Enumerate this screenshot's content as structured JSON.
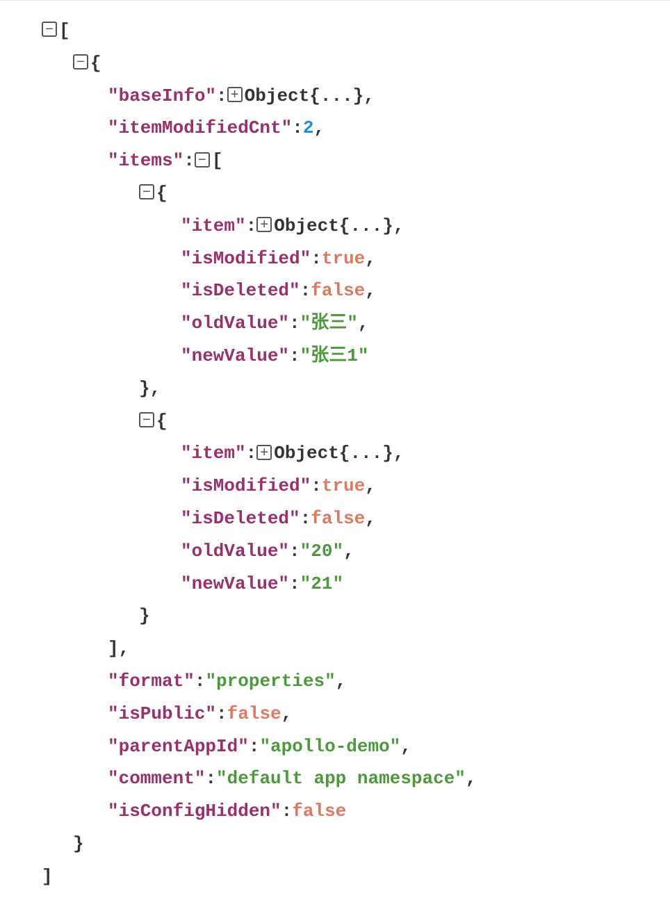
{
  "toggles": {
    "collapse": "−",
    "expand": "+"
  },
  "root": {
    "open": "[",
    "close": "]",
    "obj": {
      "open": "{",
      "close": "}",
      "baseInfo": {
        "key": "\"baseInfo\"",
        "value": "Object{...}"
      },
      "itemModifiedCnt": {
        "key": "\"itemModifiedCnt\"",
        "value": "2"
      },
      "items": {
        "key": "\"items\"",
        "open": "[",
        "close": "]",
        "list": [
          {
            "open": "{",
            "close": "}",
            "item": {
              "key": "\"item\"",
              "value": "Object{...}"
            },
            "isModified": {
              "key": "\"isModified\"",
              "value": "true"
            },
            "isDeleted": {
              "key": "\"isDeleted\"",
              "value": "false"
            },
            "oldValue": {
              "key": "\"oldValue\"",
              "value": "\"张三\""
            },
            "newValue": {
              "key": "\"newValue\"",
              "value": "\"张三1\""
            }
          },
          {
            "open": "{",
            "close": "}",
            "item": {
              "key": "\"item\"",
              "value": "Object{...}"
            },
            "isModified": {
              "key": "\"isModified\"",
              "value": "true"
            },
            "isDeleted": {
              "key": "\"isDeleted\"",
              "value": "false"
            },
            "oldValue": {
              "key": "\"oldValue\"",
              "value": "\"20\""
            },
            "newValue": {
              "key": "\"newValue\"",
              "value": "\"21\""
            }
          }
        ]
      },
      "format": {
        "key": "\"format\"",
        "value": "\"properties\""
      },
      "isPublic": {
        "key": "\"isPublic\"",
        "value": "false"
      },
      "parentAppId": {
        "key": "\"parentAppId\"",
        "value": "\"apollo-demo\""
      },
      "comment": {
        "key": "\"comment\"",
        "value": "\"default app namespace\""
      },
      "isConfigHidden": {
        "key": "\"isConfigHidden\"",
        "value": "false"
      }
    }
  },
  "p": {
    "colon": ":",
    "comma": ","
  }
}
